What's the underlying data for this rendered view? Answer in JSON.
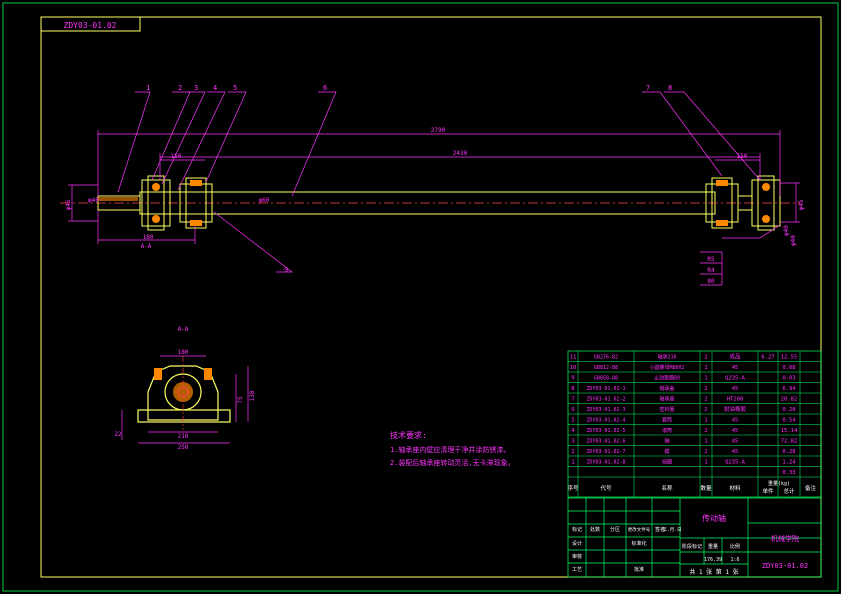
{
  "drawing": {
    "drawing_no_top": "ZDY03-01.02",
    "drawing_no_bottom": "ZDY03-01.02",
    "part_title": "传动轴",
    "company": "机械学院",
    "scale": "1:6",
    "sheet_text": "共 1 张  第 1 张",
    "section_label": "A-A",
    "section_marker": "A-A"
  },
  "callouts": [
    "1",
    "2",
    "3",
    "4",
    "5",
    "6",
    "7",
    "8",
    "9"
  ],
  "dimensions": {
    "overall_length": "2790",
    "inner_length": "2430",
    "left_offset": "150",
    "right_offset": "150",
    "left_bottom": "180",
    "shaft_dia": "φ60",
    "left_end_dia": "φ45",
    "right_end_dia": "φ45",
    "left_end_small": "φ40",
    "right_small_1": "φ40",
    "right_small_2": "φ40",
    "right_keyway_1": "R5",
    "right_keyway_2": "R4",
    "right_keyway_3": "80",
    "section_top_width": "180",
    "section_height_1": "130",
    "section_height_2": "75",
    "section_base_1": "210",
    "section_base_2": "250",
    "section_side": "22"
  },
  "notes": {
    "title": "技术要求:",
    "line1": "1.轴承座内壁应清理干净并涂防锈漆。",
    "line2": "2.装配后轴承座转动灵活,无卡滞现象。"
  },
  "bom_header": [
    "序号",
    "代号",
    "名称",
    "数量",
    "材料",
    "单件",
    "总计",
    "备注"
  ],
  "bom_header_weight": "重量(kg)",
  "bom_rows": [
    [
      "11",
      "GB276-82",
      "轴承216",
      "2",
      "成品",
      "6.27",
      "12.55",
      ""
    ],
    [
      "10",
      "GB812-88",
      "小圆螺母M80X2",
      "1",
      "45",
      "",
      "0.68",
      ""
    ],
    [
      "9",
      "GB858-88",
      "止动垫圈80",
      "1",
      "Q235-A",
      "",
      "0.03",
      ""
    ],
    [
      "8",
      "ZDY03-01.02-1",
      "轴承盖",
      "2",
      "45",
      "",
      "6.94",
      ""
    ],
    [
      "7",
      "ZDY03-01.02-2",
      "轴承座",
      "2",
      "HT200",
      "",
      "20.82",
      ""
    ],
    [
      "6",
      "ZDY03-01.02-3",
      "密封圈",
      "2",
      "耐油橡胶",
      "",
      "0.28",
      ""
    ],
    [
      "5",
      "ZDY03-01.02-4",
      "套筒",
      "1",
      "45",
      "",
      "0.54",
      ""
    ],
    [
      "4",
      "ZDY03-01.02-5",
      "滚筒",
      "2",
      "45",
      "",
      "15.14",
      ""
    ],
    [
      "3",
      "ZDY03-01.02-6",
      "轴",
      "1",
      "45",
      "",
      "72.82",
      ""
    ],
    [
      "2",
      "ZDY03-01.02-7",
      "键",
      "2",
      "45",
      "",
      "0.28",
      ""
    ],
    [
      "1",
      "ZDY03-01.02-8",
      "挡圈",
      "1",
      "Q235-A",
      "",
      "1.24",
      ""
    ],
    [
      "",
      "",
      "",
      "",
      "",
      "",
      "0.33",
      ""
    ]
  ],
  "title_block": {
    "row1": [
      "标记",
      "处数",
      "分区",
      "更改文件号",
      "签名",
      "年.月.日"
    ],
    "designer": "设计",
    "standardization": "标准化",
    "checker": "审核",
    "process": "工艺",
    "approve": "批准",
    "stage_mark": "阶段标记",
    "weight": "重量",
    "scale_label": "比例",
    "weight_value": "176.39"
  },
  "colors": {
    "frame": "#ffff66",
    "dimension": "#ff33ff",
    "part": "#ffff66",
    "accent": "#ff8800",
    "table": "#00ff66"
  }
}
